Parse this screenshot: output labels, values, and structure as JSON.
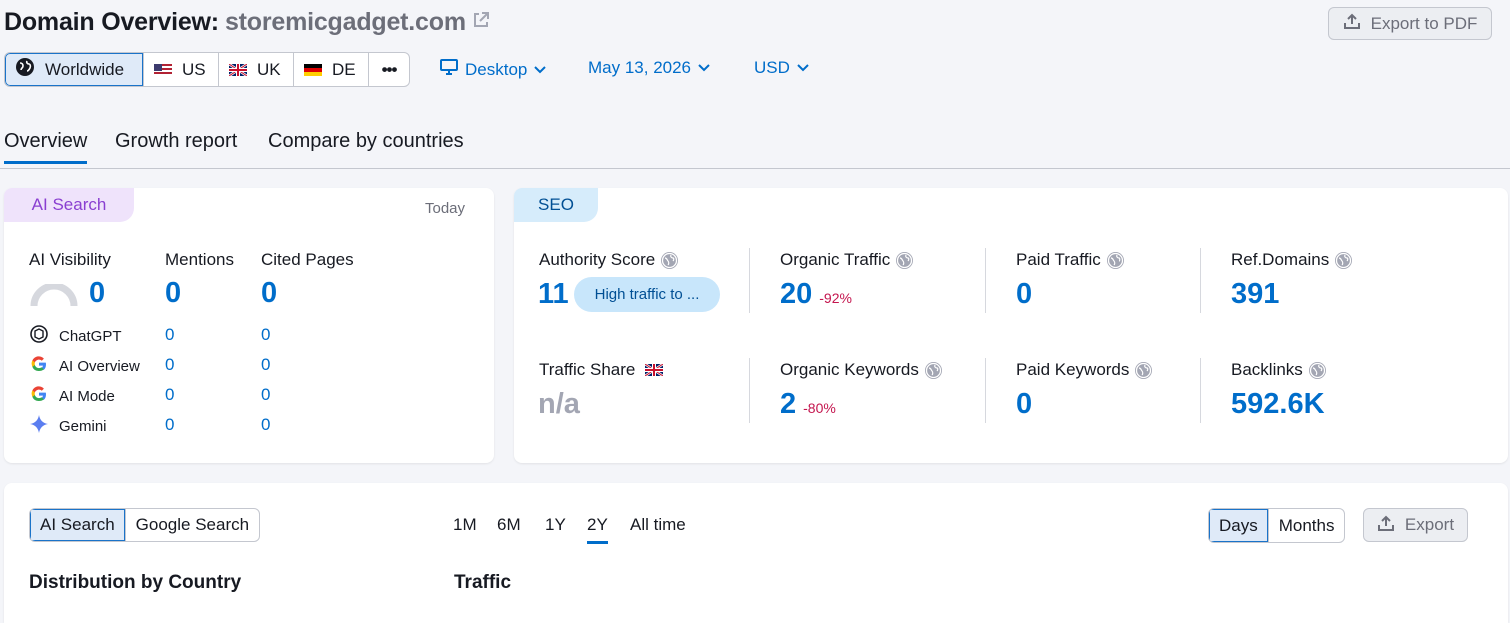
{
  "header": {
    "title_prefix": "Domain Overview:",
    "domain": "storemicgadget.com",
    "export_pdf": "Export to PDF"
  },
  "region": {
    "items": [
      {
        "label": "Worldwide",
        "active": true
      },
      {
        "label": "US"
      },
      {
        "label": "UK"
      },
      {
        "label": "DE"
      }
    ],
    "more": "•••"
  },
  "filters": {
    "device": "Desktop",
    "date": "May 13, 2026",
    "currency": "USD"
  },
  "tabs": [
    "Overview",
    "Growth report",
    "Compare by countries"
  ],
  "ai_card": {
    "chip": "AI Search",
    "period": "Today",
    "cols": [
      "AI Visibility",
      "Mentions",
      "Cited Pages"
    ],
    "totals": [
      "0",
      "0",
      "0"
    ],
    "rows": [
      {
        "name": "ChatGPT",
        "mentions": "0",
        "cited": "0"
      },
      {
        "name": "AI Overview",
        "mentions": "0",
        "cited": "0"
      },
      {
        "name": "AI Mode",
        "mentions": "0",
        "cited": "0"
      },
      {
        "name": "Gemini",
        "mentions": "0",
        "cited": "0"
      }
    ]
  },
  "seo_card": {
    "chip": "SEO",
    "authority": {
      "label": "Authority Score",
      "value": "11",
      "badge": "High traffic to ..."
    },
    "organic_traffic": {
      "label": "Organic Traffic",
      "value": "20",
      "change": "-92%"
    },
    "paid_traffic": {
      "label": "Paid Traffic",
      "value": "0"
    },
    "ref_domains": {
      "label": "Ref.Domains",
      "value": "391"
    },
    "traffic_share": {
      "label": "Traffic Share",
      "value": "n/a"
    },
    "organic_keywords": {
      "label": "Organic Keywords",
      "value": "2",
      "change": "-80%"
    },
    "paid_keywords": {
      "label": "Paid Keywords",
      "value": "0"
    },
    "backlinks": {
      "label": "Backlinks",
      "value": "592.6K"
    }
  },
  "bottom": {
    "source_toggle": [
      "AI Search",
      "Google Search"
    ],
    "periods": [
      "1M",
      "6M",
      "1Y",
      "2Y",
      "All time"
    ],
    "active_period": "2Y",
    "granularity": [
      "Days",
      "Months"
    ],
    "export": "Export",
    "dist_title": "Distribution by Country",
    "traffic_title": "Traffic"
  },
  "colors": {
    "accent": "#006dca",
    "negative": "#c4154e",
    "ai_chip": "#efe3fb",
    "seo_chip": "#d6ecfb"
  }
}
